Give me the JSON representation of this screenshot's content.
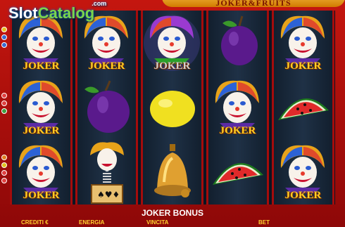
{
  "watermark": {
    "slot": "Slot",
    "catalog": "Catalog",
    "domain": ".com"
  },
  "game_title": "JOKER&FRUITS",
  "symbol_label": "JOKER",
  "reels": [
    [
      "joker",
      "joker",
      "joker"
    ],
    [
      "joker",
      "plum",
      "jack-in-the-box"
    ],
    [
      "joker",
      "lemon",
      "bell"
    ],
    [
      "plum",
      "joker",
      "watermelon"
    ],
    [
      "joker",
      "watermelon",
      "joker"
    ]
  ],
  "bonus_text": "JOKER BONUS",
  "meters": {
    "credits_label": "CREDITI €",
    "energy_label": "ENERGIA",
    "win_label": "VINCITA",
    "bet_label": "BET"
  },
  "colors": {
    "frame": "#a50d0d",
    "joker_text": "#ffd026",
    "label": "#ffd330"
  }
}
